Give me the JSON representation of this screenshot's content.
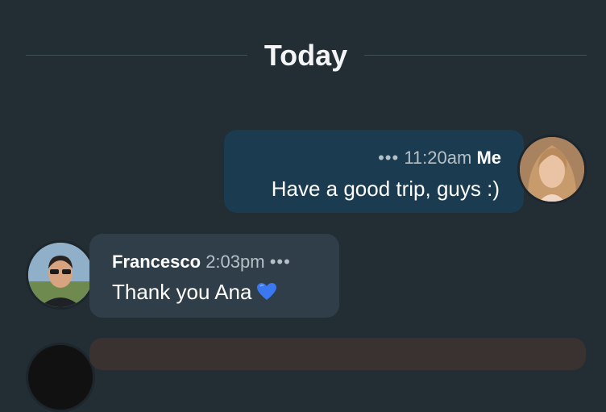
{
  "divider": {
    "label": "Today"
  },
  "messages": [
    {
      "sender": "Me",
      "time": "11:20am",
      "options": "•••",
      "text": "Have a good trip, guys :)"
    },
    {
      "sender": "Francesco",
      "time": "2:03pm",
      "options": "•••",
      "text": "Thank you Ana"
    }
  ],
  "icons": {
    "heart": "blue-heart-emoji"
  },
  "colors": {
    "background": "#222d34",
    "my_bubble": "#1b3b50",
    "other_bubble": "#2f3e48",
    "heart": "#3a78f2"
  }
}
